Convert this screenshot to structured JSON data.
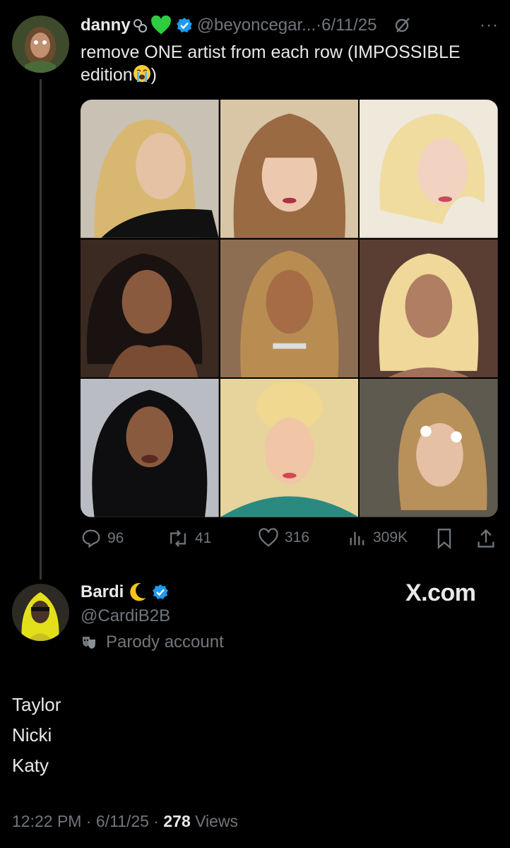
{
  "tweet": {
    "author_name": "danny",
    "handle": "@beyoncegar...",
    "date": "·6/11/25",
    "more": "···",
    "text": "remove ONE artist from each row (IMPOSSIBLE edition",
    "text_suffix": ")",
    "emoji": "loudly-crying-face",
    "icons": [
      "ring-icon",
      "green-heart-icon",
      "verified-badge-icon",
      "grok-icon",
      "more-icon"
    ],
    "images": [
      "photo-1",
      "photo-2",
      "photo-3",
      "photo-4",
      "photo-5",
      "photo-6",
      "photo-7",
      "photo-8",
      "photo-9"
    ],
    "stats": {
      "replies": "96",
      "reposts": "41",
      "likes": "316",
      "views": "309K"
    }
  },
  "reply": {
    "author_name": "Bardi",
    "handle": "@CardiB2B",
    "label": "Parody account",
    "body_lines": [
      "Taylor",
      "Nicki",
      "Katy"
    ],
    "time": "12:22 PM · 6/11/25 · ",
    "views_count": "278",
    "views_label": " Views"
  },
  "watermark": "X.com",
  "colors": {
    "background": "#000000",
    "text": "#e7e9ea",
    "muted": "#71767b",
    "verified": "#1d9bf0",
    "green_heart": "#2ecc40"
  }
}
